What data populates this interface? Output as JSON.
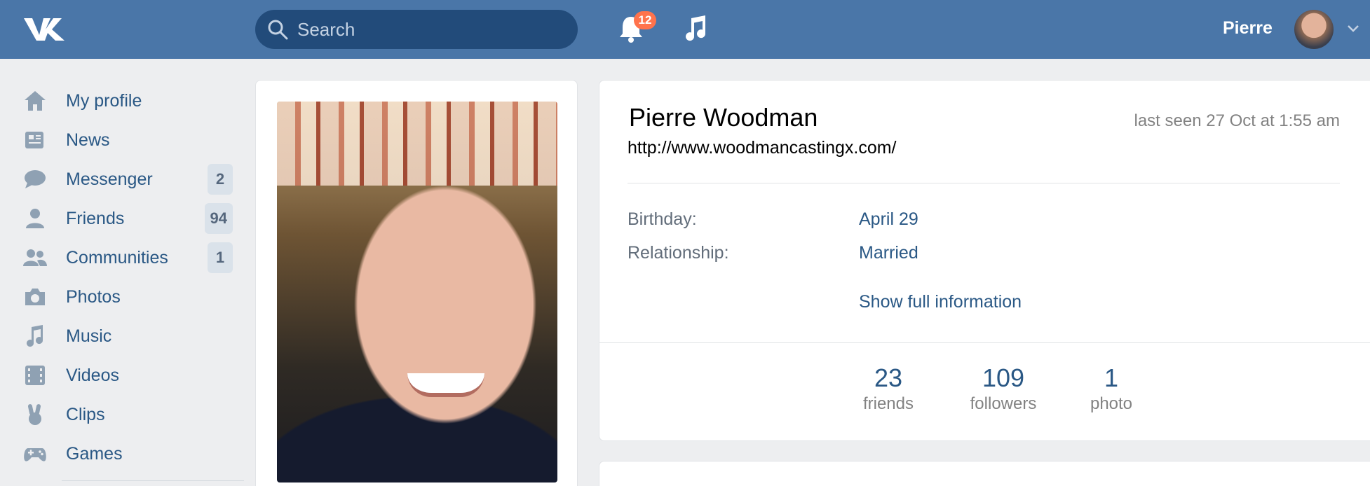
{
  "header": {
    "search_placeholder": "Search",
    "notifications_count": "12",
    "user_name": "Pierre",
    "colors": {
      "bar": "#4a76a8",
      "search": "#224b7a",
      "badge": "#ff734c"
    }
  },
  "sidebar": {
    "items": [
      {
        "label": "My profile",
        "icon": "home-icon"
      },
      {
        "label": "News",
        "icon": "news-icon"
      },
      {
        "label": "Messenger",
        "icon": "messenger-icon",
        "count": "2"
      },
      {
        "label": "Friends",
        "icon": "friends-icon",
        "count": "94"
      },
      {
        "label": "Communities",
        "icon": "communities-icon",
        "count": "1"
      },
      {
        "label": "Photos",
        "icon": "camera-icon"
      },
      {
        "label": "Music",
        "icon": "music-icon"
      },
      {
        "label": "Videos",
        "icon": "film-icon"
      },
      {
        "label": "Clips",
        "icon": "clips-icon"
      },
      {
        "label": "Games",
        "icon": "gamepad-icon"
      }
    ]
  },
  "profile": {
    "name": "Pierre Woodman",
    "last_seen": "last seen 27 Oct at 1:55 am",
    "website": "http://www.woodmancastingx.com/",
    "birthday_label": "Birthday:",
    "birthday_value": "April 29",
    "relationship_label": "Relationship:",
    "relationship_value": "Married",
    "show_full": "Show full information",
    "counters": [
      {
        "num": "23",
        "cap": "friends"
      },
      {
        "num": "109",
        "cap": "followers"
      },
      {
        "num": "1",
        "cap": "photo"
      }
    ]
  }
}
